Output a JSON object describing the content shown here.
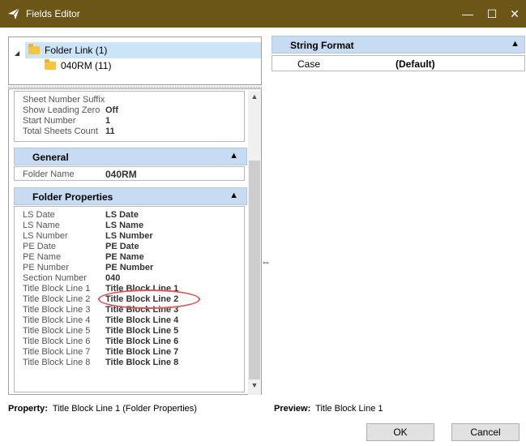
{
  "window": {
    "title": "Fields Editor",
    "title_bar_color": "#6b5617",
    "controls": {
      "minimize": "—",
      "maximize": "☐",
      "close": "✕"
    }
  },
  "tree": {
    "items": [
      {
        "label": "Folder Link (1)",
        "icon": "folder-icon",
        "selected": true
      },
      {
        "label": "040RM (11)",
        "icon": "folder-icon",
        "selected": false
      }
    ]
  },
  "sheet_numbering": {
    "rows": [
      {
        "key": "Sheet Number Suffix",
        "value": ""
      },
      {
        "key": "Show Leading Zero",
        "value": "Off"
      },
      {
        "key": "Start Number",
        "value": "1"
      },
      {
        "key": "Total Sheets Count",
        "value": "11"
      }
    ]
  },
  "general": {
    "title": "General",
    "rows": [
      {
        "key": "Folder Name",
        "value": "040RM"
      }
    ]
  },
  "folder_properties": {
    "title": "Folder Properties",
    "rows": [
      {
        "key": "LS Date",
        "value": "LS Date"
      },
      {
        "key": "LS Name",
        "value": "LS Name"
      },
      {
        "key": "LS Number",
        "value": "LS Number"
      },
      {
        "key": "PE Date",
        "value": "PE Date"
      },
      {
        "key": "PE Name",
        "value": "PE Name"
      },
      {
        "key": "PE Number",
        "value": "PE Number"
      },
      {
        "key": "Section Number",
        "value": "040"
      },
      {
        "key": "Title Block Line 1",
        "value": "Title Block Line 1"
      },
      {
        "key": "Title Block Line 2",
        "value": "Title Block Line 2"
      },
      {
        "key": "Title Block Line 3",
        "value": "Title Block Line 3"
      },
      {
        "key": "Title Block Line 4",
        "value": "Title Block Line 4"
      },
      {
        "key": "Title Block Line 5",
        "value": "Title Block Line 5"
      },
      {
        "key": "Title Block Line 6",
        "value": "Title Block Line 6"
      },
      {
        "key": "Title Block Line 7",
        "value": "Title Block Line 7"
      },
      {
        "key": "Title Block Line 8",
        "value": "Title Block Line 8"
      }
    ]
  },
  "string_format": {
    "title": "String Format",
    "rows": [
      {
        "key": "Case",
        "value": "(Default)"
      }
    ]
  },
  "footer": {
    "property_label": "Property:",
    "property_value": "Title Block Line 1 (Folder Properties)",
    "preview_label": "Preview:",
    "preview_value": "Title Block Line 1",
    "ok_label": "OK",
    "cancel_label": "Cancel"
  },
  "colors": {
    "section_header": "#c7dcf2",
    "selection": "#cce4f7",
    "highlight": "#d65a5a"
  }
}
